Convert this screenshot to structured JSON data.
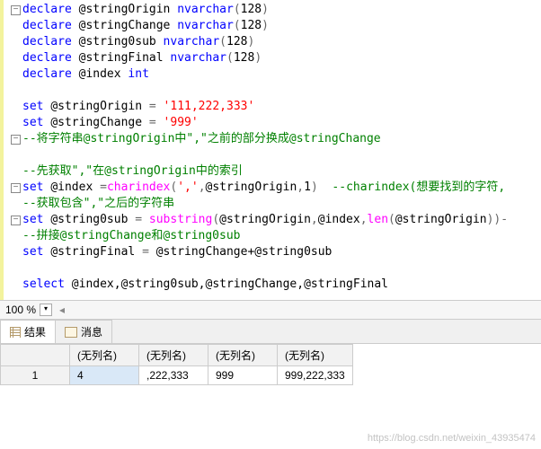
{
  "code": {
    "l1": {
      "kw": "declare",
      "v": "@stringOrigin",
      "t": "nvarchar",
      "n": "128"
    },
    "l2": {
      "kw": "declare",
      "v": "@stringChange",
      "t": "nvarchar",
      "n": "128"
    },
    "l3": {
      "kw": "declare",
      "v": "@string0sub",
      "t": "nvarchar",
      "n": "128"
    },
    "l4": {
      "kw": "declare",
      "v": "@stringFinal",
      "t": "nvarchar",
      "n": "128"
    },
    "l5": {
      "kw": "declare",
      "v": "@index",
      "t": "int"
    },
    "l7a": "set",
    "l7v": "@stringOrigin",
    "l7s": "'111,222,333'",
    "l8a": "set",
    "l8v": "@stringChange",
    "l8s": "'999'",
    "c1": "--将字符串@stringOrigin中\",\"之前的部分换成@stringChange",
    "c2": "--先获取\",\"在@stringOrigin中的索引",
    "l12a": "set",
    "l12v": "@index",
    "l12f": "charindex",
    "l12args": "','",
    "l12arg2": "@stringOrigin",
    "l12arg3": "1",
    "l12c": "--charindex(想要找到的字符,",
    "c3": "--获取包含\",\"之后的字符串",
    "l14a": "set",
    "l14v": "@string0sub",
    "l14f": "substring",
    "l14a1": "@stringOrigin",
    "l14a2": "@index",
    "l14f2": "len",
    "l14a3": "@stringOrigin",
    "c4": "--拼接@stringChange和@string0sub",
    "l16a": "set",
    "l16v": "@stringFinal",
    "l16e": "@stringChange+@string0sub",
    "l18a": "select",
    "l18e": "@index,@string0sub,@stringChange,@stringFinal"
  },
  "zoom": "100 %",
  "fold_glyph": "−",
  "tabs": {
    "results": "结果",
    "messages": "消息"
  },
  "grid": {
    "headers": [
      "",
      "(无列名)",
      "(无列名)",
      "(无列名)",
      "(无列名)"
    ],
    "rownum": "1",
    "row": [
      "4",
      ",222,333",
      "999",
      "999,222,333"
    ]
  },
  "watermark": "https://blog.csdn.net/weixin_43935474"
}
